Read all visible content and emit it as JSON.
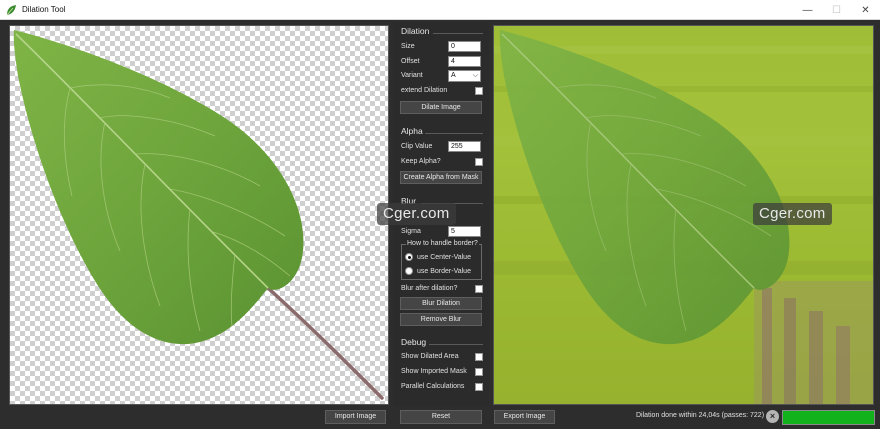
{
  "window": {
    "title": "Dilation Tool",
    "controls": {
      "minimize": "—",
      "maximize": "☐",
      "close": "✕"
    }
  },
  "dilation": {
    "title": "Dilation",
    "size_label": "Size",
    "size_value": "0",
    "offset_label": "Offset",
    "offset_value": "4",
    "variant_label": "Variant",
    "variant_value": "A",
    "extend_label": "extend Dilation",
    "dilate_button": "Dilate Image"
  },
  "alpha": {
    "title": "Alpha",
    "clip_label": "Clip Value",
    "clip_value": "255",
    "keep_label": "Keep Alpha?",
    "create_button": "Create Alpha from Mask"
  },
  "blur": {
    "title": "Blur",
    "sigma_label": "Sigma",
    "sigma_value": "5",
    "border_group_title": "How to handle border?",
    "center_option": "use Center-Value",
    "border_option": "use Border-Value",
    "selected_option": "center",
    "after_label": "Blur after dilation?",
    "blur_button": "Blur Dilation",
    "remove_button": "Remove Blur"
  },
  "debug": {
    "title": "Debug",
    "show_dilated_label": "Show Dilated Area",
    "show_imported_label": "Show Imported Mask",
    "parallel_label": "Parallel Calculations"
  },
  "watermark": "Cger.com",
  "bottom": {
    "import_button": "Import Image",
    "reset_button": "Reset",
    "export_button": "Export Image",
    "status": "Dilation done within 24,04s (passes: 722)",
    "progress_percent": 100
  },
  "colors": {
    "accent_green": "#12b21c",
    "panel_bg": "#2b2b2b",
    "leaf_green": "#6fa33d",
    "dilated_bg": "#9fbd36"
  }
}
